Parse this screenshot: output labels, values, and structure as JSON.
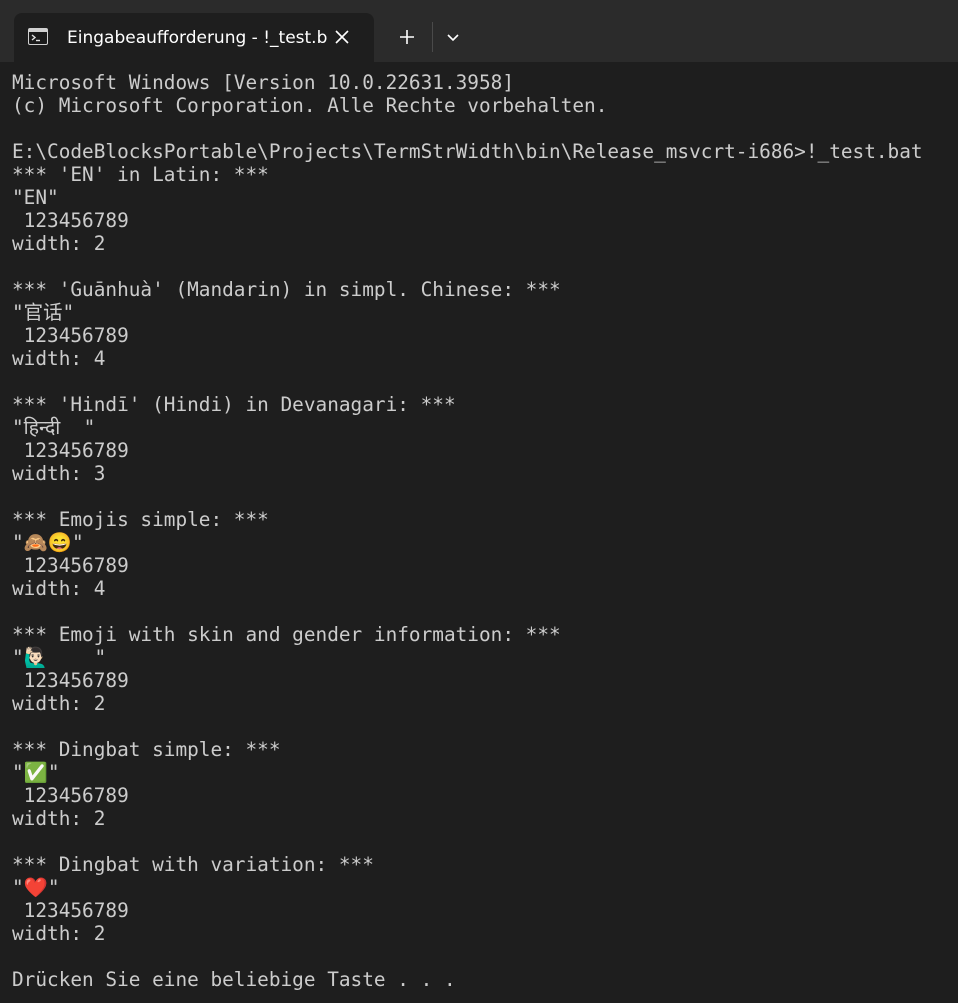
{
  "tab": {
    "title": "Eingabeaufforderung - !_test.bat",
    "icon": "command-prompt-icon"
  },
  "toolbar": {
    "new_tab_icon": "plus-icon",
    "dropdown_icon": "chevron-down-icon",
    "close_icon": "close-icon"
  },
  "colors": {
    "titlebar": "#2b2b2b",
    "background": "#1e1e1e",
    "text": "#cccccc"
  },
  "terminal": {
    "lines": [
      "Microsoft Windows [Version 10.0.22631.3958]",
      "(c) Microsoft Corporation. Alle Rechte vorbehalten.",
      "",
      "E:\\CodeBlocksPortable\\Projects\\TermStrWidth\\bin\\Release_msvcrt-i686>!_test.bat",
      "*** 'EN' in Latin: ***",
      "\"EN\"",
      " 123456789",
      "width: 2",
      "",
      "*** 'Guānhuà' (Mandarin) in simpl. Chinese: ***",
      "\"官话\"",
      " 123456789",
      "width: 4",
      "",
      "*** 'Hindī' (Hindi) in Devanagari: ***",
      "\"हिन्दी  \"",
      " 123456789",
      "width: 3",
      "",
      "*** Emojis simple: ***",
      "\"🙈😄\"",
      " 123456789",
      "width: 4",
      "",
      "*** Emoji with skin and gender information: ***",
      "\"🙋🏻‍♂️    \"",
      " 123456789",
      "width: 2",
      "",
      "*** Dingbat simple: ***",
      "\"✅\"",
      " 123456789",
      "width: 2",
      "",
      "*** Dingbat with variation: ***",
      "\"❤️\"",
      " 123456789",
      "width: 2",
      "",
      "Drücken Sie eine beliebige Taste . . ."
    ]
  }
}
